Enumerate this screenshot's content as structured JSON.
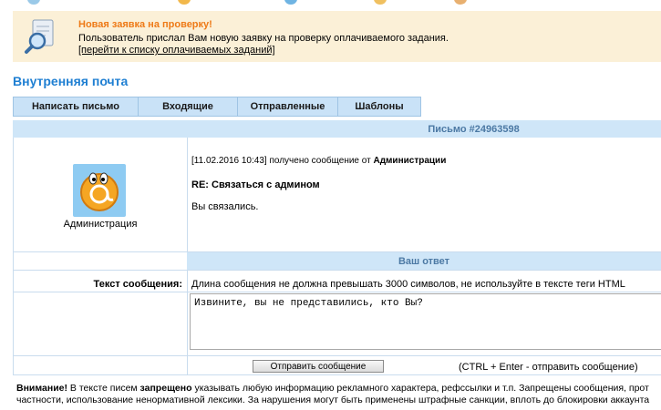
{
  "notice": {
    "title": "Новая заявка на проверку!",
    "text": "Пользователь прислал Вам новую заявку на проверку оплачиваемого задания.",
    "link": "[перейти к списку оплачиваемых заданий]"
  },
  "mail": {
    "section_title": "Внутренняя почта",
    "tabs": [
      "Написать письмо",
      "Входящие",
      "Отправленные",
      "Шаблоны"
    ],
    "letter_header": "Письмо #24963598",
    "sender_name": "Администрация",
    "date": "[11.02.2016 10:43]",
    "received_text": " получено сообщение от ",
    "from": "Администрации",
    "subject": "RE: Связаться с админом",
    "body": "Вы связались.",
    "reply_header": "Ваш ответ",
    "message_label": "Текст сообщения:",
    "hint": "Длина сообщения не должна превышать 3000 символов, не используйте в тексте теги HTML",
    "reply_text": "Извините, вы не представились, кто Вы?",
    "send_button": "Отправить сообщение",
    "shortcut": "(CTRL + Enter - отправить сообщение)"
  },
  "warning": {
    "label": "Внимание!",
    "part1": " В тексте писем ",
    "forbidden": "запрещено",
    "part2": " указывать любую информацию рекламного характера, рефссылки и т.п. Запрещены сообщения, прот",
    "line2": "частности, использование ненормативной лексики. За нарушения могут быть применены штрафные санкции, вплоть до блокировки аккаунта"
  },
  "colors": {
    "accent": "#1f7fd2",
    "notice_title": "#ee7a17",
    "notice_bg": "#fbf0d7",
    "tab_bg": "#c9e2f7",
    "header_bg": "#cfe6f8"
  }
}
